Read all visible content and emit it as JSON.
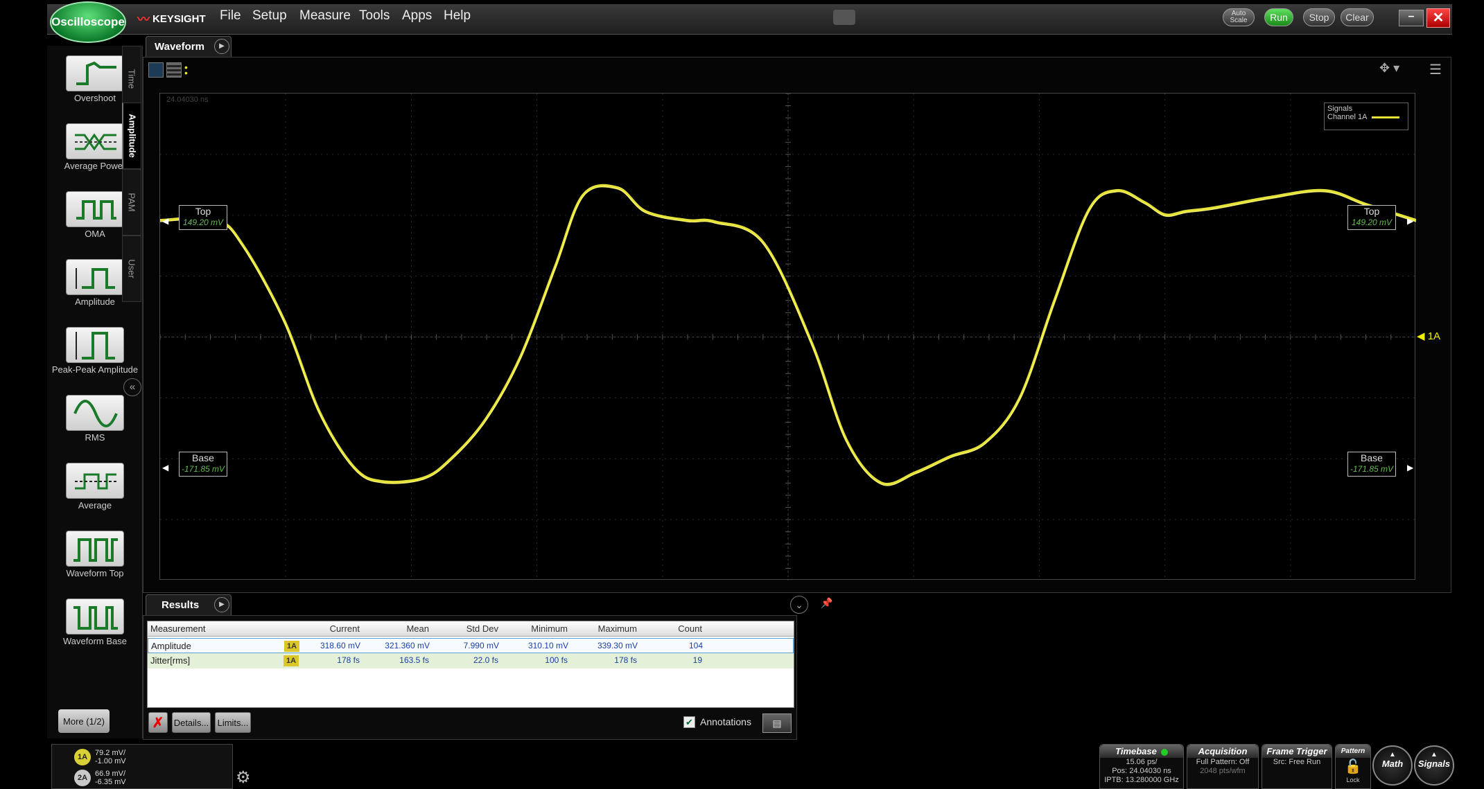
{
  "app": {
    "logo_label": "Oscilloscope",
    "brand": "KEYSIGHT",
    "menu": [
      "File",
      "Setup",
      "Measure",
      "Tools",
      "Apps",
      "Help"
    ],
    "buttons": {
      "autoscale": "Auto Scale",
      "run": "Run",
      "stop": "Stop",
      "clear": "Clear"
    },
    "minimize": "–",
    "close": "✕"
  },
  "palette": {
    "items": [
      {
        "label": "Overshoot",
        "icon": "overshoot-icon"
      },
      {
        "label": "Average Power",
        "icon": "average-power-icon"
      },
      {
        "label": "OMA",
        "icon": "oma-icon"
      },
      {
        "label": "Amplitude",
        "icon": "amplitude-icon"
      },
      {
        "label": "Peak-Peak Amplitude",
        "icon": "peak-peak-amplitude-icon"
      },
      {
        "label": "RMS",
        "icon": "rms-icon"
      },
      {
        "label": "Average",
        "icon": "average-icon"
      },
      {
        "label": "Waveform Top",
        "icon": "waveform-top-icon"
      },
      {
        "label": "Waveform Base",
        "icon": "waveform-base-icon"
      }
    ],
    "more": "More (1/2)"
  },
  "vtabs": [
    "Time",
    "Amplitude",
    "PAM",
    "User"
  ],
  "waveform": {
    "tab_label": "Waveform",
    "timestamp": "24.04030 ns",
    "markers": {
      "top_label": "Top",
      "top_value": "149.20 mV",
      "base_label": "Base",
      "base_value": "-171.85 mV"
    },
    "legend": {
      "title": "Signals",
      "channel": "Channel 1A"
    },
    "channel_marker": "1A",
    "trace_color": "#e5e23a"
  },
  "results": {
    "tab_label": "Results",
    "headers": [
      "Measurement",
      "Current",
      "Mean",
      "Std Dev",
      "Minimum",
      "Maximum",
      "Count"
    ],
    "rows": [
      {
        "name": "Amplitude",
        "source": "1A",
        "current": "318.60 mV",
        "mean": "321.360 mV",
        "std": "7.990 mV",
        "min": "310.10 mV",
        "max": "339.30 mV",
        "count": "104"
      },
      {
        "name": "Jitter[rms]",
        "source": "1A",
        "current": "178 fs",
        "mean": "163.5 fs",
        "std": "22.0 fs",
        "min": "100 fs",
        "max": "178 fs",
        "count": "19"
      }
    ],
    "delete_icon": "✗",
    "details": "Details...",
    "limits": "Limits...",
    "annotations": "Annotations",
    "annotations_checked": true
  },
  "channels": [
    {
      "id": "1A",
      "scale": "79.2 mV/",
      "offset": "-1.00 mV",
      "color": "#d9cf36"
    },
    {
      "id": "2A",
      "scale": "66.9 mV/",
      "offset": "-6.35 mV",
      "color": "#c9c9c9"
    }
  ],
  "status": {
    "timebase": {
      "title": "Timebase",
      "line1": "15.06 ps/",
      "line2": "Pos: 24.04030 ns",
      "line3": "IPTB: 13.280000 GHz"
    },
    "acquisition": {
      "title": "Acquisition",
      "line1": "Full Pattern: Off",
      "line2": "2048 pts/wfm"
    },
    "frame_trigger": {
      "title": "Frame Trigger",
      "line1": "Src: Free Run"
    },
    "pattern": {
      "title": "Pattern",
      "line1": "Lock"
    },
    "math": "Math",
    "signals": "Signals"
  }
}
